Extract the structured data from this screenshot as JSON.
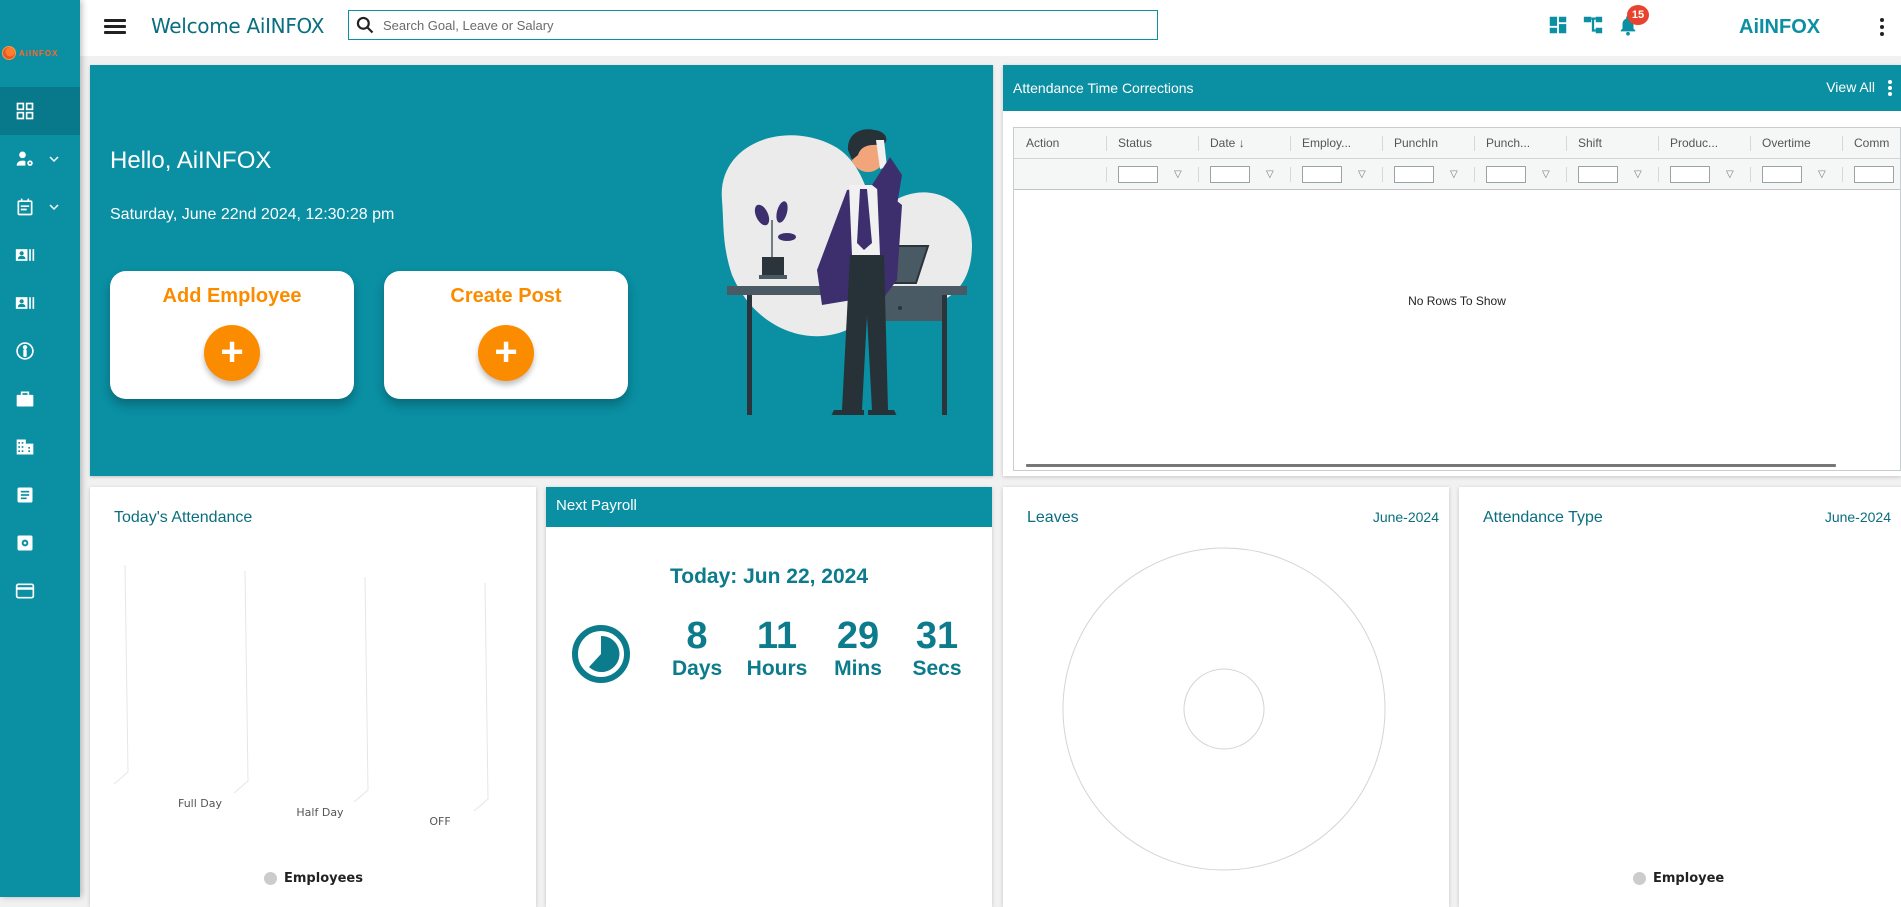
{
  "brand": {
    "logo_text": "AiINFOX"
  },
  "sidebar": {
    "items": [
      {
        "icon": "dashboard-icon",
        "active": true
      },
      {
        "icon": "user-settings-icon",
        "has_chevron": true
      },
      {
        "icon": "calendar-note-icon",
        "has_chevron": true
      },
      {
        "icon": "id-card-icon"
      },
      {
        "icon": "id-card-icon"
      },
      {
        "icon": "person-circle-icon"
      },
      {
        "icon": "briefcase-icon"
      },
      {
        "icon": "building-icon"
      },
      {
        "icon": "document-icon"
      },
      {
        "icon": "settings-box-icon"
      },
      {
        "icon": "credit-card-icon"
      }
    ]
  },
  "header": {
    "welcome": "Welcome AiINFOX",
    "search_placeholder": "Search Goal, Leave or Salary",
    "search_value": "",
    "notification_count": "15",
    "user_name": "AiINFOX"
  },
  "hero": {
    "greeting": "Hello, AiINFOX",
    "datetime": "Saturday, June 22nd 2024, 12:30:28 pm",
    "actions": [
      {
        "label": "Add Employee",
        "icon": "+"
      },
      {
        "label": "Create Post",
        "icon": "+"
      }
    ]
  },
  "attendance_corrections": {
    "title": "Attendance Time Corrections",
    "view_all": "View All",
    "columns": [
      "Action",
      "Status",
      "Date",
      "Employ...",
      "PunchIn",
      "Punch...",
      "Shift",
      "Produc...",
      "Overtime",
      "Comm"
    ],
    "sort_indicator": "↓",
    "sorted_column": "Date",
    "empty_message": "No Rows To Show"
  },
  "todays_attendance": {
    "title": "Today's Attendance",
    "legend": "Employees"
  },
  "next_payroll": {
    "title": "Next Payroll",
    "today": "Today: Jun 22, 2024",
    "countdown": [
      {
        "value": "8",
        "unit": "Days"
      },
      {
        "value": "11",
        "unit": "Hours"
      },
      {
        "value": "29",
        "unit": "Mins"
      },
      {
        "value": "31",
        "unit": "Secs"
      }
    ]
  },
  "leaves": {
    "title": "Leaves",
    "month": "June-2024"
  },
  "attendance_type": {
    "title": "Attendance Type",
    "month": "June-2024",
    "legend": "Employee"
  },
  "colors": {
    "primary": "#0a8fa3",
    "accent": "#fb8c00",
    "badge": "#e8432e"
  },
  "chart_data": [
    {
      "type": "bar",
      "title": "Today's Attendance",
      "categories": [
        "Full Day",
        "Half Day",
        "OFF"
      ],
      "series": [
        {
          "name": "Employees",
          "values": [
            0,
            0,
            0
          ]
        }
      ]
    },
    {
      "type": "pie",
      "title": "Leaves",
      "subtitle": "June-2024",
      "categories": [],
      "values": []
    },
    {
      "type": "pie",
      "title": "Attendance Type",
      "subtitle": "June-2024",
      "series": [
        {
          "name": "Employee",
          "values": []
        }
      ]
    }
  ]
}
